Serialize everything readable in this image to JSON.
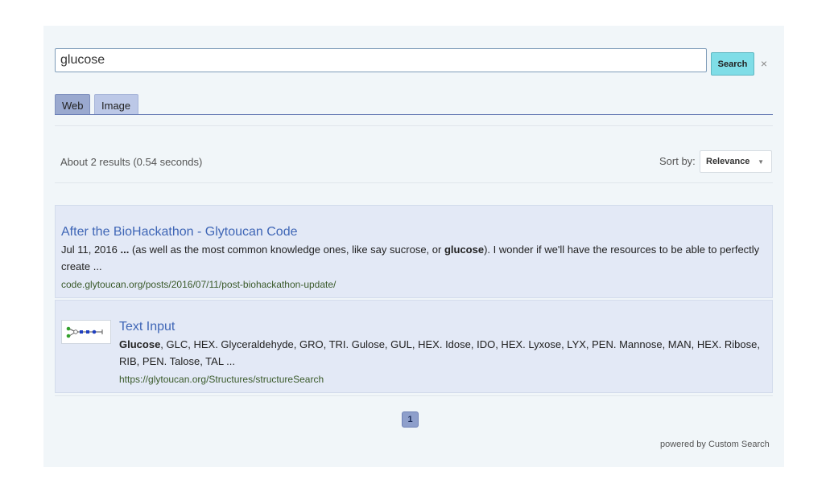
{
  "search": {
    "query": "glucose",
    "button_label": "Search",
    "clear_glyph": "×"
  },
  "tabs": [
    {
      "label": "Web",
      "selected": true
    },
    {
      "label": "Image",
      "selected": false
    }
  ],
  "results_info": "About 2 results (0.54 seconds)",
  "sort": {
    "label": "Sort by:",
    "value": "Relevance",
    "caret": "▼"
  },
  "results": [
    {
      "title": "After the BioHackathon - Glytoucan Code",
      "snippet_line1_pre": "Jul 11, 2016 ",
      "snippet_line1_bold1": "...",
      "snippet_line1_mid": " (as well as the most common knowledge ones, like say sucrose, or ",
      "snippet_line1_bold2": "glucose",
      "snippet_line1_post": "). I wonder if we'll have the resources to be able to perfectly",
      "snippet_line2": "create ...",
      "url": "code.glytoucan.org/posts/2016/07/11/post-biohackathon-update/"
    },
    {
      "title": "Text Input",
      "snippet_line1_bold": "Glucose",
      "snippet_line1_rest": ", GLC, HEX. Glyceraldehyde, GRO, TRI. Gulose, GUL, HEX. Idose, IDO, HEX. Lyxose, LYX, PEN. Mannose, MAN, HEX. Ribose,",
      "snippet_line2": "RIB, PEN. Talose, TAL ...",
      "url": "https://glytoucan.org/Structures/structureSearch",
      "thumbnail": "glycan-structure-thumbnail"
    }
  ],
  "pagination": {
    "current_page": "1"
  },
  "footer": {
    "powered_by": "powered by",
    "brand": "Custom Search"
  },
  "colors": {
    "panel_bg": "#f1f6f9",
    "search_button": "#7fdde7",
    "tab_selected": "#9aa9cf",
    "result_bg": "#e3e9f6",
    "link": "#3f66b6",
    "url": "#3a5a2a"
  }
}
